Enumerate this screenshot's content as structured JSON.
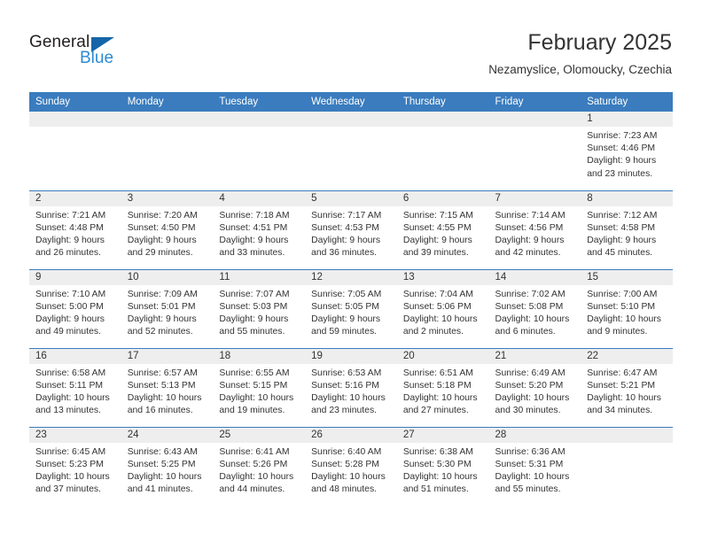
{
  "brand": {
    "name_part1": "General",
    "name_part2": "Blue",
    "triangle_icon": "triangle-icon",
    "color_dark": "#231f20",
    "color_blue": "#2e8bd0",
    "color_triangle": "#1565a8"
  },
  "header": {
    "title": "February 2025",
    "subtitle": "Nezamyslice, Olomoucky, Czechia"
  },
  "theme": {
    "header_blue": "#3a7cbe",
    "daynum_band": "#eeeeee",
    "text": "#333333"
  },
  "weekdays": [
    "Sunday",
    "Monday",
    "Tuesday",
    "Wednesday",
    "Thursday",
    "Friday",
    "Saturday"
  ],
  "weeks": [
    [
      {
        "day": "",
        "lines": []
      },
      {
        "day": "",
        "lines": []
      },
      {
        "day": "",
        "lines": []
      },
      {
        "day": "",
        "lines": []
      },
      {
        "day": "",
        "lines": []
      },
      {
        "day": "",
        "lines": []
      },
      {
        "day": "1",
        "lines": [
          "Sunrise: 7:23 AM",
          "Sunset: 4:46 PM",
          "Daylight: 9 hours",
          "and 23 minutes."
        ]
      }
    ],
    [
      {
        "day": "2",
        "lines": [
          "Sunrise: 7:21 AM",
          "Sunset: 4:48 PM",
          "Daylight: 9 hours",
          "and 26 minutes."
        ]
      },
      {
        "day": "3",
        "lines": [
          "Sunrise: 7:20 AM",
          "Sunset: 4:50 PM",
          "Daylight: 9 hours",
          "and 29 minutes."
        ]
      },
      {
        "day": "4",
        "lines": [
          "Sunrise: 7:18 AM",
          "Sunset: 4:51 PM",
          "Daylight: 9 hours",
          "and 33 minutes."
        ]
      },
      {
        "day": "5",
        "lines": [
          "Sunrise: 7:17 AM",
          "Sunset: 4:53 PM",
          "Daylight: 9 hours",
          "and 36 minutes."
        ]
      },
      {
        "day": "6",
        "lines": [
          "Sunrise: 7:15 AM",
          "Sunset: 4:55 PM",
          "Daylight: 9 hours",
          "and 39 minutes."
        ]
      },
      {
        "day": "7",
        "lines": [
          "Sunrise: 7:14 AM",
          "Sunset: 4:56 PM",
          "Daylight: 9 hours",
          "and 42 minutes."
        ]
      },
      {
        "day": "8",
        "lines": [
          "Sunrise: 7:12 AM",
          "Sunset: 4:58 PM",
          "Daylight: 9 hours",
          "and 45 minutes."
        ]
      }
    ],
    [
      {
        "day": "9",
        "lines": [
          "Sunrise: 7:10 AM",
          "Sunset: 5:00 PM",
          "Daylight: 9 hours",
          "and 49 minutes."
        ]
      },
      {
        "day": "10",
        "lines": [
          "Sunrise: 7:09 AM",
          "Sunset: 5:01 PM",
          "Daylight: 9 hours",
          "and 52 minutes."
        ]
      },
      {
        "day": "11",
        "lines": [
          "Sunrise: 7:07 AM",
          "Sunset: 5:03 PM",
          "Daylight: 9 hours",
          "and 55 minutes."
        ]
      },
      {
        "day": "12",
        "lines": [
          "Sunrise: 7:05 AM",
          "Sunset: 5:05 PM",
          "Daylight: 9 hours",
          "and 59 minutes."
        ]
      },
      {
        "day": "13",
        "lines": [
          "Sunrise: 7:04 AM",
          "Sunset: 5:06 PM",
          "Daylight: 10 hours",
          "and 2 minutes."
        ]
      },
      {
        "day": "14",
        "lines": [
          "Sunrise: 7:02 AM",
          "Sunset: 5:08 PM",
          "Daylight: 10 hours",
          "and 6 minutes."
        ]
      },
      {
        "day": "15",
        "lines": [
          "Sunrise: 7:00 AM",
          "Sunset: 5:10 PM",
          "Daylight: 10 hours",
          "and 9 minutes."
        ]
      }
    ],
    [
      {
        "day": "16",
        "lines": [
          "Sunrise: 6:58 AM",
          "Sunset: 5:11 PM",
          "Daylight: 10 hours",
          "and 13 minutes."
        ]
      },
      {
        "day": "17",
        "lines": [
          "Sunrise: 6:57 AM",
          "Sunset: 5:13 PM",
          "Daylight: 10 hours",
          "and 16 minutes."
        ]
      },
      {
        "day": "18",
        "lines": [
          "Sunrise: 6:55 AM",
          "Sunset: 5:15 PM",
          "Daylight: 10 hours",
          "and 19 minutes."
        ]
      },
      {
        "day": "19",
        "lines": [
          "Sunrise: 6:53 AM",
          "Sunset: 5:16 PM",
          "Daylight: 10 hours",
          "and 23 minutes."
        ]
      },
      {
        "day": "20",
        "lines": [
          "Sunrise: 6:51 AM",
          "Sunset: 5:18 PM",
          "Daylight: 10 hours",
          "and 27 minutes."
        ]
      },
      {
        "day": "21",
        "lines": [
          "Sunrise: 6:49 AM",
          "Sunset: 5:20 PM",
          "Daylight: 10 hours",
          "and 30 minutes."
        ]
      },
      {
        "day": "22",
        "lines": [
          "Sunrise: 6:47 AM",
          "Sunset: 5:21 PM",
          "Daylight: 10 hours",
          "and 34 minutes."
        ]
      }
    ],
    [
      {
        "day": "23",
        "lines": [
          "Sunrise: 6:45 AM",
          "Sunset: 5:23 PM",
          "Daylight: 10 hours",
          "and 37 minutes."
        ]
      },
      {
        "day": "24",
        "lines": [
          "Sunrise: 6:43 AM",
          "Sunset: 5:25 PM",
          "Daylight: 10 hours",
          "and 41 minutes."
        ]
      },
      {
        "day": "25",
        "lines": [
          "Sunrise: 6:41 AM",
          "Sunset: 5:26 PM",
          "Daylight: 10 hours",
          "and 44 minutes."
        ]
      },
      {
        "day": "26",
        "lines": [
          "Sunrise: 6:40 AM",
          "Sunset: 5:28 PM",
          "Daylight: 10 hours",
          "and 48 minutes."
        ]
      },
      {
        "day": "27",
        "lines": [
          "Sunrise: 6:38 AM",
          "Sunset: 5:30 PM",
          "Daylight: 10 hours",
          "and 51 minutes."
        ]
      },
      {
        "day": "28",
        "lines": [
          "Sunrise: 6:36 AM",
          "Sunset: 5:31 PM",
          "Daylight: 10 hours",
          "and 55 minutes."
        ]
      },
      {
        "day": "",
        "lines": []
      }
    ]
  ]
}
